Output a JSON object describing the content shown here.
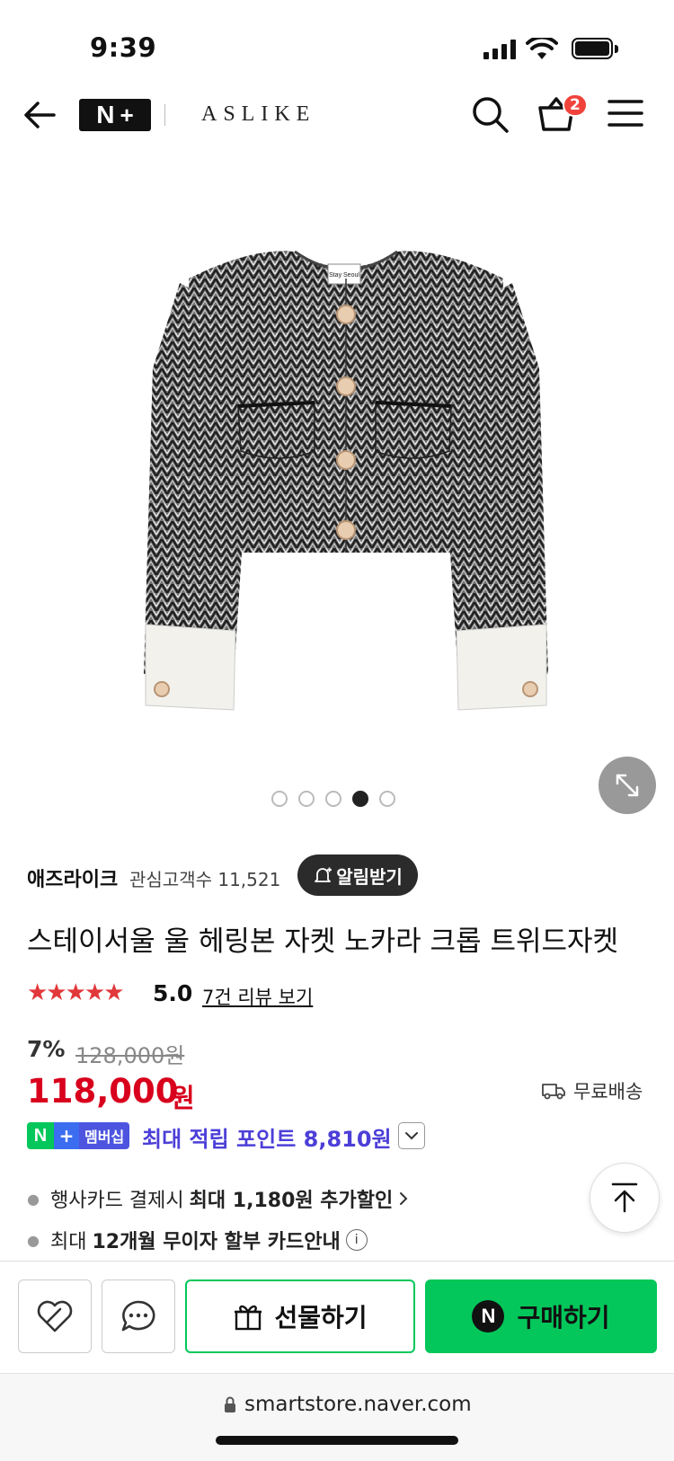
{
  "status_bar": {
    "time": "9:39"
  },
  "header": {
    "logo_n": "N",
    "logo_plus": "+",
    "brand": "ASLIKE",
    "cart_count": "2"
  },
  "gallery": {
    "dots": [
      false,
      false,
      false,
      true,
      false
    ],
    "tag_text": "Stay Seoul"
  },
  "seller": {
    "name": "애즈라이크",
    "follower_text": "관심고객수 11,521",
    "notify_label": "알림받기"
  },
  "product": {
    "title": "스테이서울 울 헤링본 자켓 노카라 크롭 트위드자켓",
    "stars": "★★★★★",
    "rating": "5.0",
    "review_link": "7건 리뷰 보기"
  },
  "price": {
    "discount": "7%",
    "original": "128,000원",
    "sale": "118,000",
    "unit": "원",
    "shipping": "무료배송"
  },
  "membership": {
    "n": "N",
    "plus": "+",
    "label": "멤버십",
    "points_text": "최대 적립 포인트 8,810원"
  },
  "benefits": {
    "card_prefix": "행사카드 결제시",
    "card_bold": "최대 1,180원 추가할인",
    "installment_prefix": "최대",
    "installment_bold": "12개월 무이자 할부 카드안내",
    "info": "i"
  },
  "actions": {
    "gift_label": "선물하기",
    "buy_label": "구매하기",
    "buy_n": "N"
  },
  "browser": {
    "url": "smartstore.naver.com"
  },
  "colors": {
    "naver_green": "#03c75a",
    "sale_red": "#d8001c",
    "star_red": "#e1383b",
    "points_purple": "#4c3fd8"
  }
}
